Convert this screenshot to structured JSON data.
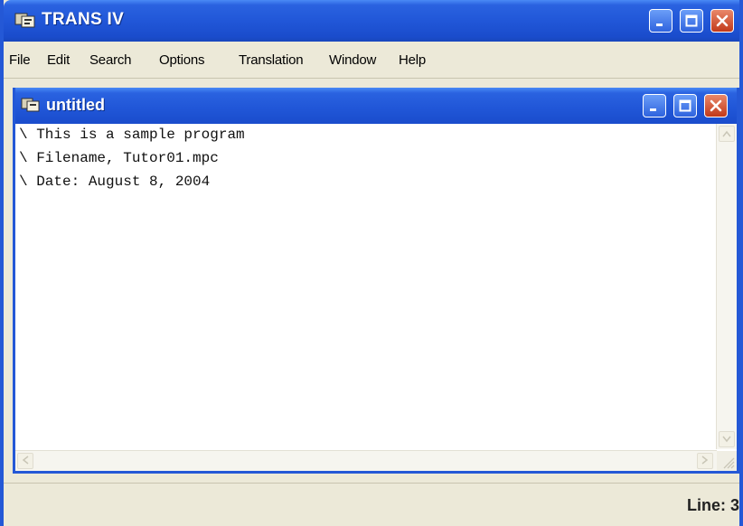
{
  "app": {
    "title": "TRANS IV",
    "icon": "trans-app-icon"
  },
  "window_controls": [
    "minimize-icon",
    "maximize-icon",
    "close-icon"
  ],
  "menu": {
    "items": [
      {
        "label": "File"
      },
      {
        "label": "Edit"
      },
      {
        "label": "Search"
      },
      {
        "label": "Options"
      },
      {
        "label": "Translation"
      },
      {
        "label": "Window"
      },
      {
        "label": "Help"
      }
    ]
  },
  "document": {
    "title": "untitled",
    "lines": [
      "\\ This is a sample program",
      "\\ Filename, Tutor01.mpc",
      "\\ Date: August 8, 2004"
    ]
  },
  "status": {
    "line": "Line: 3"
  },
  "colors": {
    "titlebar": "#2157d8",
    "close": "#c2391a",
    "chrome": "#ece9d8"
  }
}
